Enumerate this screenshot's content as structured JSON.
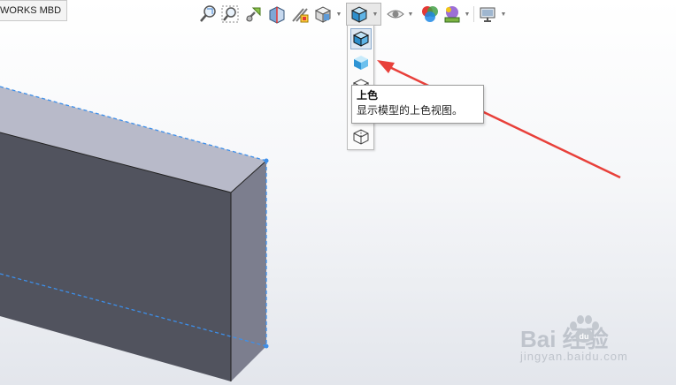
{
  "tab": {
    "label": "WORKS MBD"
  },
  "toolbar": {
    "icons": [
      "zoom-to-fit-icon",
      "zoom-to-area-icon",
      "previous-view-icon",
      "section-view-icon",
      "dynamic-annotation-view-icon",
      "view-orientation-icon",
      "display-style-icon",
      "hide-show-items-icon",
      "edit-appearance-icon",
      "apply-scene-icon",
      "view-settings-icon"
    ],
    "active_icon": "display-style-icon"
  },
  "flyout": {
    "items": [
      "shaded-with-edges-icon",
      "shaded-icon",
      "hidden-lines-removed-icon",
      "wireframe-icon"
    ],
    "highlighted_item": "shaded-with-edges-icon"
  },
  "tooltip": {
    "title": "上色",
    "description": "显示模型的上色视图。"
  },
  "annotation": {
    "arrow_color": "#e8403a"
  },
  "model": {
    "front_face_color": "#51535e",
    "top_face_color": "#b8bac9",
    "side_face_color": "#7c7e8e",
    "hidden_edge_color": "#3d8fea"
  },
  "watermark": {
    "brand": "Bai  经验",
    "url": "jingyan.baidu.com"
  }
}
